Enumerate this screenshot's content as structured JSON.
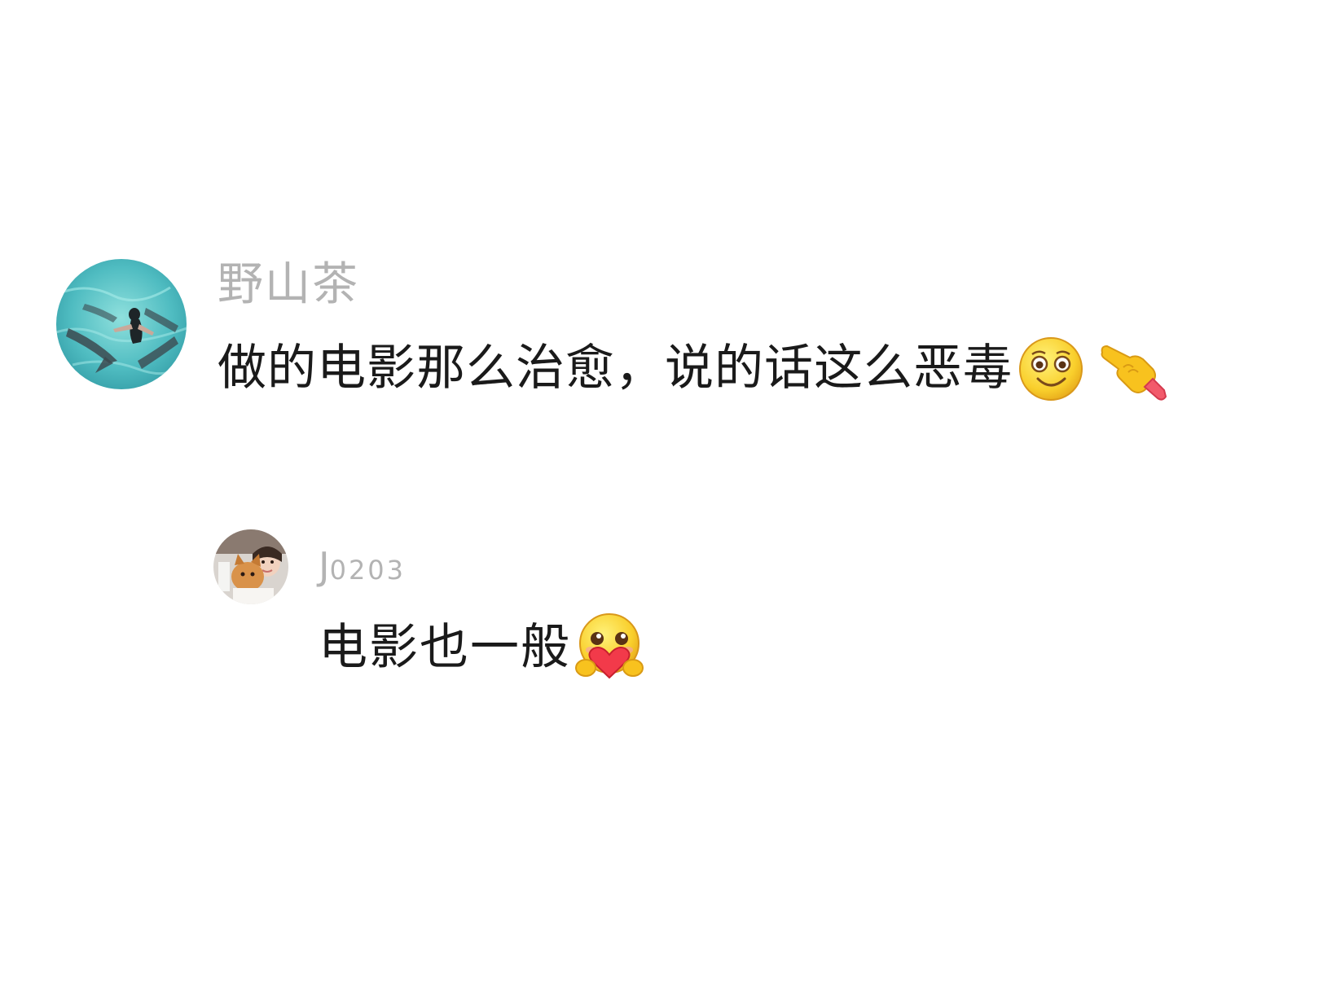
{
  "comments": [
    {
      "username": "野山茶",
      "text": "做的电影那么治愈，说的话这么恶毒",
      "avatar_icon": "avatar-swimmer-with-sharks-icon",
      "emojis": [
        "smiling-face-emoji-icon",
        "pointing-finger-emoji-icon"
      ],
      "reply": {
        "username_main": "J",
        "username_sub": "0203",
        "text": "电影也一般",
        "avatar_icon": "avatar-cat-and-child-icon",
        "emojis": [
          "face-holding-heart-emoji-icon"
        ]
      }
    }
  ],
  "colors": {
    "username": "#b3b3b3",
    "text": "#1a1a1a",
    "background": "#ffffff"
  }
}
